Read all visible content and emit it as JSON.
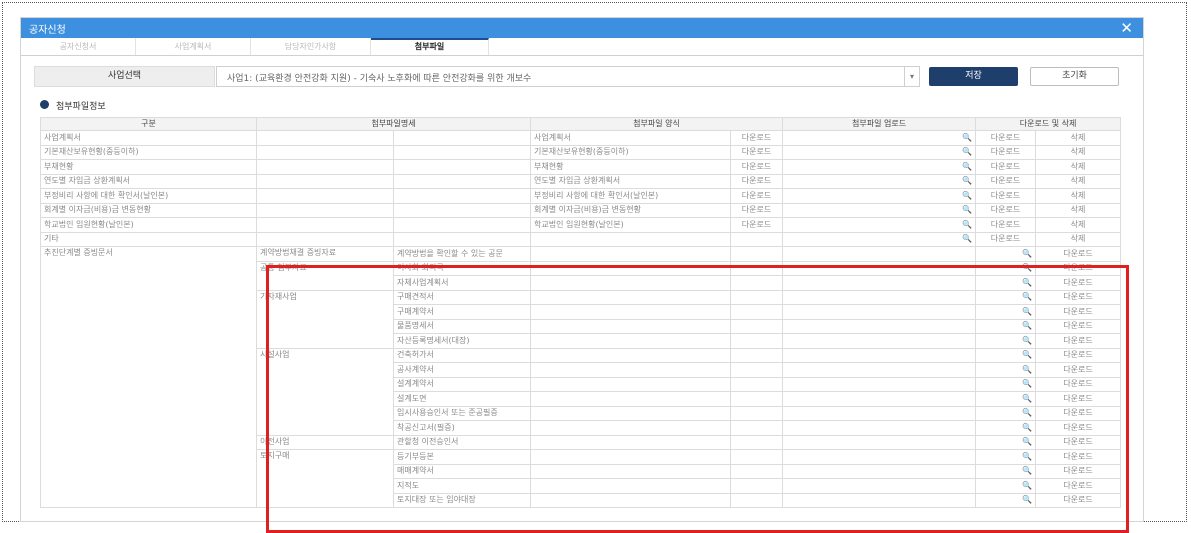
{
  "window": {
    "title": "공자신청",
    "close_label": "✕"
  },
  "tabs": [
    "공자신청서",
    "사업계획서",
    "담당자인가사항",
    "첨부파일"
  ],
  "form": {
    "select_label": "사업선택",
    "select_value": "사업1: (교육환경 안전강화 지원) - 기숙사 노후화에 따른 안전강화를 위한 개보수",
    "save_label": "저장",
    "reset_label": "초기화"
  },
  "section": {
    "title": "첨부파일정보"
  },
  "table": {
    "headers": [
      "구분",
      "첨부파일명세",
      "첨부파일 양식",
      "첨부파일 업로드",
      "다운로드 및 삭제"
    ],
    "download_label": "다운로드",
    "delete_label": "삭제",
    "search_glyph": "🔍",
    "top_rows": [
      {
        "category": "사업계획서",
        "form": "사업계획서",
        "form_download": "다운로드"
      },
      {
        "category": "기본재산보유현황(중등이하)",
        "form": "기본재산보유현황(중등이하)",
        "form_download": "다운로드"
      },
      {
        "category": "부채현황",
        "form": "부채현황",
        "form_download": "다운로드"
      },
      {
        "category": "연도별 자입금 상환계획서",
        "form": "연도별 자입금 상환계획서",
        "form_download": "다운로드"
      },
      {
        "category": "부정비리 사항에 대한 확인서(날인본)",
        "form": "부정비리 사항에 대한 확인서(날인본)",
        "form_download": "다운로드"
      },
      {
        "category": "회계별 이자금(비용)금 변동현황",
        "form": "회계별 이자금(비용)금 변동현황",
        "form_download": "다운로드"
      },
      {
        "category": "학교법인 임원현황(날인본)",
        "form": "학교법인 임원현황(날인본)",
        "form_download": "다운로드"
      },
      {
        "category": "기타",
        "form": "",
        "form_download": ""
      }
    ],
    "proof_category": "추진단계별 증빙문서",
    "proof_groups": [
      {
        "name": "계약방법채결 증빙자료",
        "items": [
          "계약방법을 확인할 수 있는 공문"
        ]
      },
      {
        "name": "공통 첨부자료",
        "items": [
          "이사회 회의록",
          "자체사업계획서"
        ]
      },
      {
        "name": "기자재사업",
        "items": [
          "구매견적서",
          "구매계약서",
          "물품명세서",
          "자산등록명세서(대장)"
        ]
      },
      {
        "name": "시설사업",
        "items": [
          "건축허가서",
          "공사계약서",
          "설계계약서",
          "설계도면",
          "임시사용승인서 또는 준공필증",
          "착공신고서(필증)"
        ]
      },
      {
        "name": "이전사업",
        "items": [
          "관할청 이전승인서"
        ]
      },
      {
        "name": "토지구매",
        "items": [
          "등기부등본",
          "매매계약서",
          "지적도",
          "토지대장 또는 임야대장"
        ]
      }
    ]
  }
}
